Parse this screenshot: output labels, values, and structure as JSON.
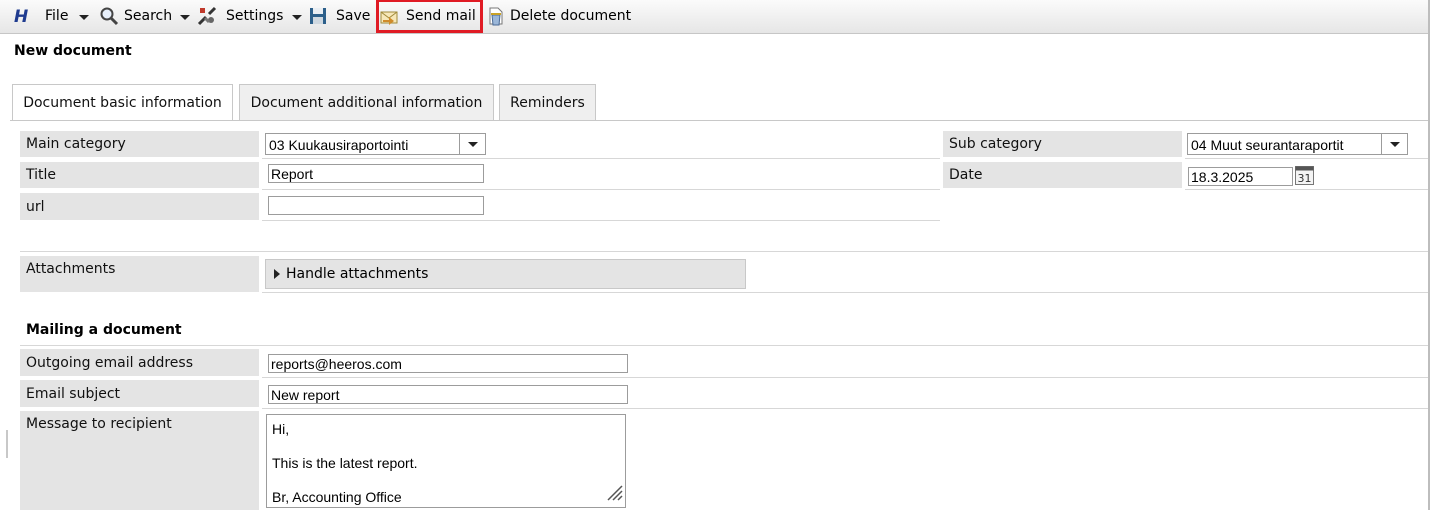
{
  "toolbar": {
    "file_label": "File",
    "search_label": "Search",
    "settings_label": "Settings",
    "save_label": "Save",
    "send_mail_label": "Send mail",
    "delete_label": "Delete document"
  },
  "page": {
    "title": "New document"
  },
  "tabs": [
    {
      "label": "Document basic information",
      "active": true
    },
    {
      "label": "Document additional information",
      "active": false
    },
    {
      "label": "Reminders",
      "active": false
    }
  ],
  "form": {
    "main_category_label": "Main category",
    "main_category_value": "03 Kuukausiraportointi",
    "sub_category_label": "Sub category",
    "sub_category_value": "04 Muut seurantaraportit",
    "title_label": "Title",
    "title_value": "Report",
    "date_label": "Date",
    "date_value": "18.3.2025",
    "calendar_day": "31",
    "url_label": "url",
    "url_value": "",
    "attachments_label": "Attachments",
    "handle_attachments": "Handle attachments"
  },
  "mailing": {
    "section_title": "Mailing a document",
    "outgoing_label": "Outgoing email address",
    "outgoing_value": "reports@heeros.com",
    "subject_label": "Email subject",
    "subject_value": "New report",
    "message_label": "Message to recipient",
    "message_lines": [
      "Hi,",
      "This is the latest report.",
      "Br, Accounting Office"
    ]
  },
  "colors": {
    "highlight": "#e01b24",
    "label_bg": "#e4e4e4",
    "logo": "#1f3b8f"
  }
}
